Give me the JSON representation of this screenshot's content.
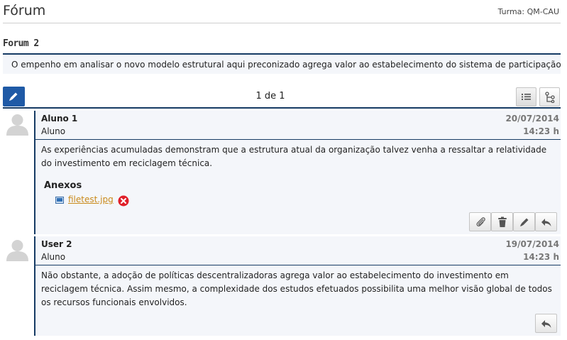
{
  "header": {
    "title": "Fórum",
    "turma": "Turma:  QM-CAU"
  },
  "forum": {
    "name": "Forum 2",
    "description": "O empenho em analisar o novo modelo estrutural aqui preconizado agrega valor ao estabelecimento do sistema de participação geral."
  },
  "toolbar": {
    "new_post_icon": "pencil-icon",
    "pager": "1 de 1",
    "list_view_icon": "list-icon",
    "tree_view_icon": "tree-icon"
  },
  "posts": [
    {
      "author": "Aluno 1",
      "role": "Aluno",
      "date": "20/07/2014",
      "time": "14:23 h",
      "body": "As experiências acumuladas demonstram que a estrutura atual da organização talvez venha a ressaltar a relatividade do investimento em reciclagem técnica.",
      "attachments_title": "Anexos",
      "attachments": [
        {
          "name": "filetest.jpg"
        }
      ],
      "actions": [
        "paperclip-icon",
        "trash-icon",
        "pencil-icon",
        "reply-icon"
      ]
    },
    {
      "author": "User 2",
      "role": "Aluno",
      "date": "19/07/2014",
      "time": "14:23 h",
      "body": "Não obstante, a adoção de políticas descentralizadoras agrega valor ao estabelecimento do investimento em reciclagem técnica. Assim mesmo, a complexidade dos estudos efetuados possibilita uma melhor visão global de todos os recursos funcionais envolvidos.",
      "actions": [
        "reply-icon"
      ]
    }
  ],
  "colors": {
    "accent_navy": "#163b64",
    "button_blue": "#1f5aa6",
    "post_bg": "#f4f6fa",
    "link_orange": "#c98a1b",
    "remove_red": "#e0202a"
  }
}
